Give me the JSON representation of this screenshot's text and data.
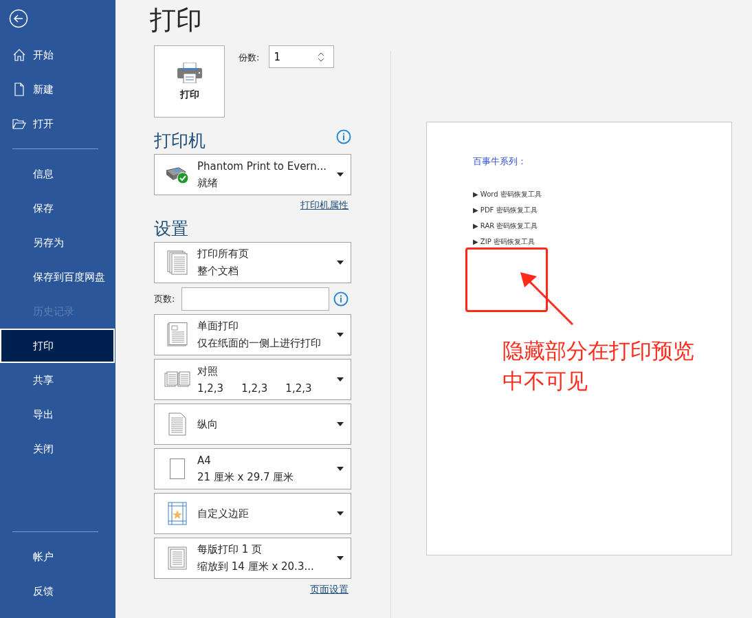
{
  "sidebar": {
    "top_items": [
      {
        "label": "开始",
        "kind": "home"
      },
      {
        "label": "新建",
        "kind": "new"
      },
      {
        "label": "打开",
        "kind": "open"
      }
    ],
    "middle_items": [
      {
        "label": "信息",
        "selected": false,
        "disabled": false
      },
      {
        "label": "保存",
        "selected": false,
        "disabled": false
      },
      {
        "label": "另存为",
        "selected": false,
        "disabled": false
      },
      {
        "label": "保存到百度网盘",
        "selected": false,
        "disabled": false
      },
      {
        "label": "历史记录",
        "selected": false,
        "disabled": true
      },
      {
        "label": "打印",
        "selected": true,
        "disabled": false
      },
      {
        "label": "共享",
        "selected": false,
        "disabled": false
      },
      {
        "label": "导出",
        "selected": false,
        "disabled": false
      },
      {
        "label": "关闭",
        "selected": false,
        "disabled": false
      }
    ],
    "bottom_items": [
      {
        "label": "帐户"
      },
      {
        "label": "反馈"
      }
    ]
  },
  "title": "打印",
  "print_button": {
    "label": "打印"
  },
  "copies": {
    "label": "份数:",
    "value": "1"
  },
  "printer": {
    "heading": "打印机",
    "name": "Phantom Print to Evern...",
    "status": "就绪",
    "properties_link": "打印机属性"
  },
  "settings": {
    "heading": "设置",
    "items": [
      {
        "kind": "pages",
        "line1": "打印所有页",
        "line2": "整个文档"
      },
      {
        "kind": "field",
        "label": "页数:"
      },
      {
        "kind": "sides",
        "line1": "单面打印",
        "line2": "仅在纸面的一侧上进行打印"
      },
      {
        "kind": "collate",
        "line1": "对照",
        "line2_parts": [
          "1,2,3",
          "1,2,3",
          "1,2,3"
        ]
      },
      {
        "kind": "orientation",
        "line1": "纵向"
      },
      {
        "kind": "paper",
        "line1": "A4",
        "line2": "21 厘米 x 29.7 厘米"
      },
      {
        "kind": "margins",
        "line1": "自定义边距"
      },
      {
        "kind": "persheet",
        "line1": "每版打印 1 页",
        "line2": "缩放到 14 厘米 x 20.3..."
      }
    ],
    "page_setup_link": "页面设置"
  },
  "preview": {
    "heading": "百事牛系列：",
    "bullets": [
      "▶ Word 密码恢复工具",
      "▶ PDF 密码恢复工具",
      "▶ RAR 密码恢复工具",
      "▶ ZIP 密码恢复工具"
    ],
    "annotation": "隐藏部分在打印预览中不可见"
  }
}
